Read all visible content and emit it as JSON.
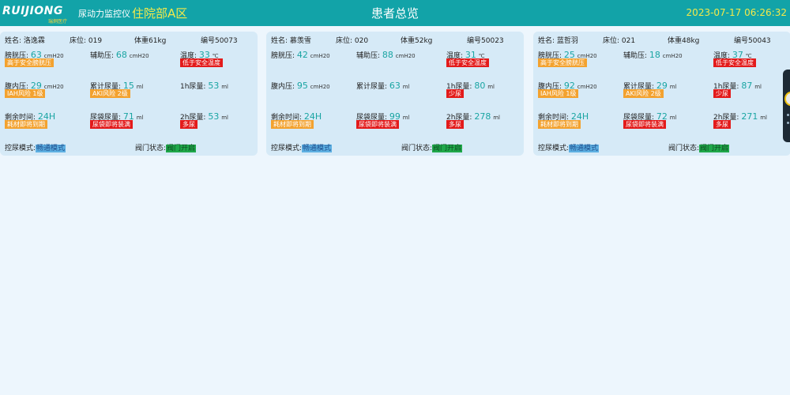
{
  "header": {
    "logo_text": "RUIJIONG",
    "logo_sub": "瑞炯医疗",
    "app_title": "尿动力监控仪",
    "ward": "住院部A区",
    "page_title": "患者总览",
    "datetime": "2023-07-17 06:26:32"
  },
  "labels": {
    "name": "姓名:",
    "bed": "床位:",
    "weight": "体重",
    "id": "编号",
    "bladder": "膀胱压:",
    "aux": "辅助压:",
    "temp": "温度:",
    "abdominal": "腹内压:",
    "cumulative": "累计尿量:",
    "h1": "1h尿量:",
    "remaining": "剩余时间:",
    "bag": "尿袋尿量:",
    "h2": "2h尿量:",
    "mode": "控尿模式:",
    "valve": "阀门状态:",
    "unit_pressure": "cmH20",
    "unit_temp": "℃",
    "unit_ml": "ml"
  },
  "colors": {
    "header_bg": "#12a3a8",
    "accent_yellow": "#f3e94a",
    "value_teal": "#1aa5a3",
    "warn_orange": "#f3a22f",
    "alarm_red": "#e31b1b",
    "mode_blue": "#5eb0e2",
    "valve_green": "#1fa84a"
  },
  "patients": [
    {
      "name": "洛逸霖",
      "bed": "019",
      "weight": "61kg",
      "id": "50073",
      "bladder": "63",
      "bladder_badge": "高于安全膀胱压",
      "aux": "68",
      "temp": "33",
      "temp_badge": "低于安全温度",
      "abdominal": "29",
      "abdominal_badge": "IAH风险 1级",
      "cumulative": "15",
      "cumulative_badge": "AKI风险 2级",
      "h1": "53",
      "remaining": "24H",
      "remaining_badge": "耗材即将到期",
      "bag": "71",
      "bag_badge": "尿袋即将装满",
      "h2": "53",
      "h2_badge": "多尿",
      "mode": "畅通模式",
      "valve": "阀门开启"
    },
    {
      "name": "慕羡雪",
      "bed": "020",
      "weight": "52kg",
      "id": "50023",
      "bladder": "42",
      "aux": "88",
      "temp": "31",
      "temp_badge": "低于安全温度",
      "abdominal": "95",
      "cumulative": "63",
      "h1": "80",
      "h1_badge": "少尿",
      "remaining": "24H",
      "remaining_badge": "耗材即将到期",
      "bag": "99",
      "bag_badge": "尿袋即将装满",
      "h2": "278",
      "h2_badge": "多尿",
      "mode": "畅通模式",
      "valve": "阀门开启"
    },
    {
      "name": "蓝哲羽",
      "bed": "021",
      "weight": "48kg",
      "id": "50043",
      "bladder": "25",
      "bladder_badge": "高于安全膀胱压",
      "aux": "18",
      "temp": "37",
      "temp_badge": "低于安全温度",
      "abdominal": "92",
      "abdominal_badge": "IAH风险 1级",
      "cumulative": "29",
      "cumulative_badge": "AKI风险 2级",
      "h1": "87",
      "h1_badge": "少尿",
      "remaining": "24H",
      "remaining_badge": "耗材即将到期",
      "bag": "72",
      "bag_badge": "尿袋即将装满",
      "h2": "271",
      "h2_badge": "多尿",
      "mode": "畅通模式",
      "valve": "阀门开启"
    }
  ]
}
